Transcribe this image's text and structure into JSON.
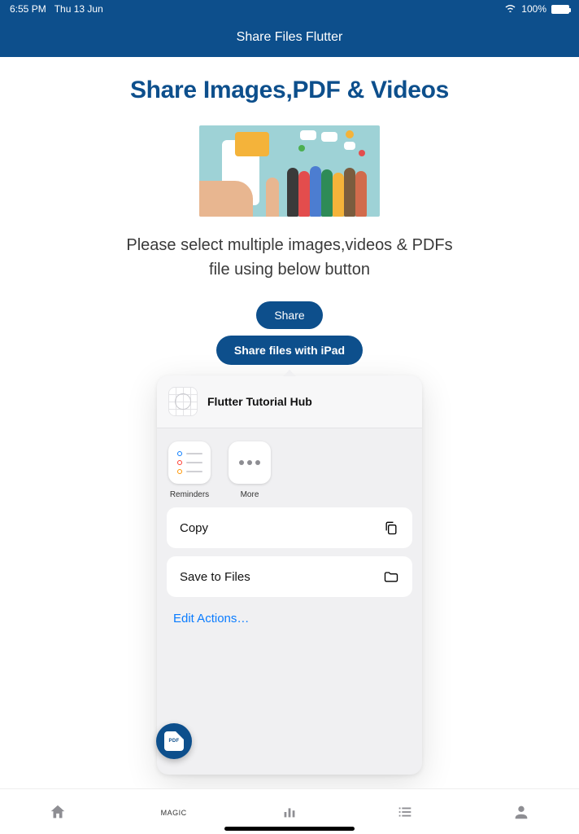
{
  "status": {
    "time": "6:55 PM",
    "date": "Thu 13 Jun",
    "battery_pct": "100%"
  },
  "app_bar": {
    "title": "Share Files Flutter"
  },
  "main": {
    "heading": "Share Images,PDF & Videos",
    "subtext": "Please select multiple images,videos & PDFs file using below button",
    "share_button_label": "Share"
  },
  "share_sheet": {
    "pill_label": "Share files with iPad",
    "source_title": "Flutter Tutorial Hub",
    "apps": [
      {
        "name": "Reminders"
      },
      {
        "name": "More"
      }
    ],
    "actions": [
      {
        "label": "Copy",
        "icon": "copy"
      },
      {
        "label": "Save to Files",
        "icon": "folder"
      }
    ],
    "edit_label": "Edit Actions…"
  },
  "fab": {
    "pdf_label": "PDF"
  },
  "bottom_nav": {
    "items": [
      {
        "icon": "home",
        "label": ""
      },
      {
        "icon": "magic",
        "label": "MAGIC"
      },
      {
        "icon": "chart",
        "label": ""
      },
      {
        "icon": "list",
        "label": ""
      },
      {
        "icon": "person",
        "label": ""
      }
    ]
  }
}
